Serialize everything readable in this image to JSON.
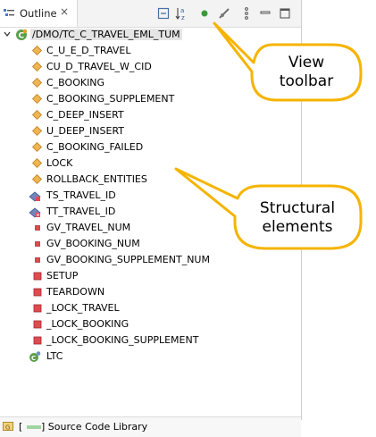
{
  "tab": {
    "label": "Outline",
    "close_glyph": "×"
  },
  "toolbar": {
    "icons": [
      "collapse-all-icon",
      "sort-alphabetically-icon",
      "green-dot-icon",
      "hide-non-public-icon",
      "view-menu-icon",
      "minimize-icon",
      "maximize-icon"
    ]
  },
  "tree": {
    "root": {
      "label": "/DMO/TC_C_TRAVEL_EML_TUM"
    },
    "items": [
      {
        "label": "C_U_E_D_TRAVEL",
        "kind": "method"
      },
      {
        "label": "CU_D_TRAVEL_W_CID",
        "kind": "method"
      },
      {
        "label": "C_BOOKING",
        "kind": "method"
      },
      {
        "label": "C_BOOKING_SUPPLEMENT",
        "kind": "method"
      },
      {
        "label": "C_DEEP_INSERT",
        "kind": "method"
      },
      {
        "label": "U_DEEP_INSERT",
        "kind": "method"
      },
      {
        "label": "C_BOOKING_FAILED",
        "kind": "method"
      },
      {
        "label": "LOCK",
        "kind": "method"
      },
      {
        "label": "ROLLBACK_ENTITIES",
        "kind": "method"
      },
      {
        "label": "TS_TRAVEL_ID",
        "kind": "type"
      },
      {
        "label": "TT_TRAVEL_ID",
        "kind": "type-table"
      },
      {
        "label": "GV_TRAVEL_NUM",
        "kind": "attribute"
      },
      {
        "label": "GV_BOOKING_NUM",
        "kind": "attribute"
      },
      {
        "label": "GV_BOOKING_SUPPLEMENT_NUM",
        "kind": "attribute"
      },
      {
        "label": "SETUP",
        "kind": "private-method"
      },
      {
        "label": "TEARDOWN",
        "kind": "private-method"
      },
      {
        "label": "_LOCK_TRAVEL",
        "kind": "private-method"
      },
      {
        "label": "_LOCK_BOOKING",
        "kind": "private-method"
      },
      {
        "label": "_LOCK_BOOKING_SUPPLEMENT",
        "kind": "private-method"
      },
      {
        "label": "LTC",
        "kind": "local-class"
      }
    ]
  },
  "status": {
    "bracket_open": "[",
    "library_label": "] Source Code Library"
  },
  "callouts": [
    {
      "line1": "View",
      "line2": "toolbar"
    },
    {
      "line1": "Structural",
      "line2": "elements"
    }
  ],
  "colors": {
    "callout_border": "#f5b400",
    "callout_fill": "#ffffff",
    "method_icon": "#e8a13a",
    "private_icon": "#d0383d",
    "selection": "#e5e5e5"
  }
}
